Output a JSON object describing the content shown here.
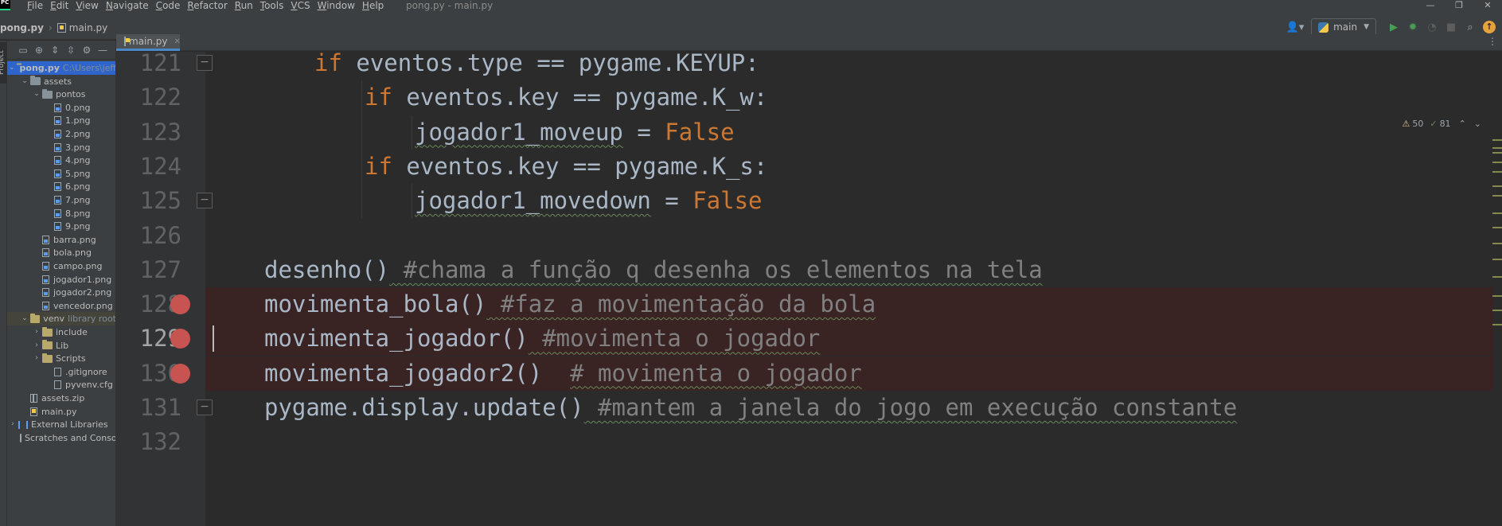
{
  "app": {
    "logo_text": "PC",
    "menu": [
      "File",
      "Edit",
      "View",
      "Navigate",
      "Code",
      "Refactor",
      "Run",
      "Tools",
      "VCS",
      "Window",
      "Help"
    ],
    "window_title": "pong.py - main.py",
    "window_controls": [
      "—",
      "❐",
      "✕"
    ]
  },
  "navbar": {
    "project": "pong.py",
    "file": "main.py",
    "run_config": "main",
    "icons": [
      "user-icon",
      "run-icon",
      "debug-icon",
      "profile-icon",
      "stop-icon",
      "search-icon",
      "update-icon"
    ]
  },
  "sidebar": {
    "tab_label": "Project",
    "tree": [
      {
        "label": "pong.py",
        "hint": "C:\\Users\\jeffe",
        "type": "folder",
        "depth": 0,
        "open": true,
        "bold": true
      },
      {
        "label": "assets",
        "type": "folder",
        "depth": 1,
        "open": true
      },
      {
        "label": "pontos",
        "type": "folder",
        "depth": 2,
        "open": true
      },
      {
        "label": "0.png",
        "type": "img",
        "depth": 3
      },
      {
        "label": "1.png",
        "type": "img",
        "depth": 3
      },
      {
        "label": "2.png",
        "type": "img",
        "depth": 3
      },
      {
        "label": "3.png",
        "type": "img",
        "depth": 3
      },
      {
        "label": "4.png",
        "type": "img",
        "depth": 3
      },
      {
        "label": "5.png",
        "type": "img",
        "depth": 3
      },
      {
        "label": "6.png",
        "type": "img",
        "depth": 3
      },
      {
        "label": "7.png",
        "type": "img",
        "depth": 3
      },
      {
        "label": "8.png",
        "type": "img",
        "depth": 3
      },
      {
        "label": "9.png",
        "type": "img",
        "depth": 3
      },
      {
        "label": "barra.png",
        "type": "img",
        "depth": 2
      },
      {
        "label": "bola.png",
        "type": "img",
        "depth": 2
      },
      {
        "label": "campo.png",
        "type": "img",
        "depth": 2
      },
      {
        "label": "jogador1.png",
        "type": "img",
        "depth": 2
      },
      {
        "label": "jogador2.png",
        "type": "img",
        "depth": 2
      },
      {
        "label": "vencedor.png",
        "type": "img",
        "depth": 2
      },
      {
        "label": "venv",
        "hint": "library root",
        "type": "venv",
        "depth": 1,
        "open": true
      },
      {
        "label": "include",
        "type": "venv",
        "depth": 2,
        "open": false
      },
      {
        "label": "Lib",
        "type": "venv",
        "depth": 2,
        "open": false
      },
      {
        "label": "Scripts",
        "type": "venv",
        "depth": 2,
        "open": false
      },
      {
        "label": ".gitignore",
        "type": "file",
        "depth": 3
      },
      {
        "label": "pyvenv.cfg",
        "type": "file",
        "depth": 3
      },
      {
        "label": "assets.zip",
        "type": "zip",
        "depth": 1
      },
      {
        "label": "main.py",
        "type": "py",
        "depth": 1
      },
      {
        "label": "External Libraries",
        "type": "lib",
        "depth": 0,
        "open": false
      },
      {
        "label": "Scratches and Consoles",
        "type": "scratch",
        "depth": 0
      }
    ]
  },
  "tabs": [
    {
      "label": "main.py",
      "active": true
    }
  ],
  "inspection": {
    "warnings": "50",
    "weak_warnings": "81"
  },
  "editor": {
    "lines": [
      {
        "n": "121",
        "indent": 2,
        "tokens": [
          [
            "kw",
            "if"
          ],
          [
            "t",
            " eventos.type == pygame.KEYUP:"
          ]
        ]
      },
      {
        "n": "122",
        "indent": 3,
        "tokens": [
          [
            "kw",
            "if"
          ],
          [
            "t",
            " eventos.key == pygame.K_w:"
          ]
        ]
      },
      {
        "n": "123",
        "indent": 4,
        "tokens": [
          [
            "sq",
            "jogador1_moveup"
          ],
          [
            "t",
            " = "
          ],
          [
            "kw",
            "False"
          ]
        ]
      },
      {
        "n": "124",
        "indent": 3,
        "tokens": [
          [
            "kw",
            "if"
          ],
          [
            "t",
            " eventos.key == pygame.K_s:"
          ]
        ]
      },
      {
        "n": "125",
        "indent": 4,
        "tokens": [
          [
            "sq",
            "jogador1_movedown"
          ],
          [
            "t",
            " = "
          ],
          [
            "kw",
            "False"
          ]
        ]
      },
      {
        "n": "126",
        "indent": 0,
        "tokens": []
      },
      {
        "n": "127",
        "indent": 1,
        "tokens": [
          [
            "t",
            "desenho()"
          ],
          [
            "cm",
            " #chama a função q desenha os elementos na tela"
          ]
        ]
      },
      {
        "n": "128",
        "indent": 1,
        "tokens": [
          [
            "t",
            "movimenta_bola()"
          ],
          [
            "cm",
            " #faz a movimentação da bola"
          ]
        ],
        "breakpoint": true
      },
      {
        "n": "129",
        "indent": 1,
        "tokens": [
          [
            "t",
            "movimenta_jogador()"
          ],
          [
            "cm",
            " #movimenta o jogador"
          ]
        ],
        "breakpoint": true,
        "current": true
      },
      {
        "n": "130",
        "indent": 1,
        "tokens": [
          [
            "t",
            "movimenta_jogador2()  "
          ],
          [
            "cm",
            "# movimenta o jogador"
          ]
        ],
        "breakpoint": true
      },
      {
        "n": "131",
        "indent": 1,
        "tokens": [
          [
            "t",
            "pygame.display.update()"
          ],
          [
            "cm",
            " #mantem a janela do jogo em execução constante"
          ]
        ]
      },
      {
        "n": "132",
        "indent": 0,
        "tokens": []
      }
    ]
  },
  "colors": {
    "keyword": "#cc7832",
    "comment": "#808080",
    "text": "#a9b7c6",
    "breakpoint": "#c75450",
    "breakpoint_line": "#3a2323",
    "selection": "#2f65ca"
  }
}
